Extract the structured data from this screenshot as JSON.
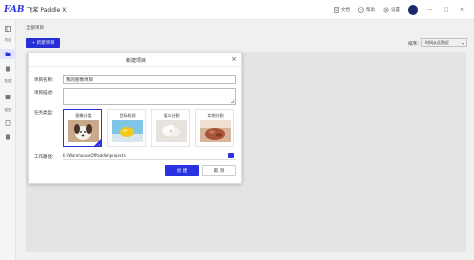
{
  "app": {
    "logo_mark": "FAB",
    "title": "飞桨 Paddle X"
  },
  "topbar": {
    "docs_label": "文档",
    "help_label": "帮助",
    "settings_label": "设置",
    "minimize": "—",
    "maximize": "□",
    "close": "×"
  },
  "sidebar": {
    "items": [
      {
        "icon": "menu-icon",
        "label": ""
      },
      {
        "icon": "project-icon",
        "label": "项目"
      },
      {
        "icon": "file-icon",
        "label": ""
      },
      {
        "icon": "data-icon",
        "label": "数据"
      },
      {
        "icon": "gear-icon",
        "label": ""
      },
      {
        "icon": "model-icon",
        "label": "模型"
      }
    ]
  },
  "main": {
    "breadcrumb": "全部项目",
    "new_project_button": "+ 新建项目",
    "sort_label": "排序：",
    "sort_value": "时间从远到近"
  },
  "modal": {
    "title": "新建项目",
    "name_label": "项目名称:",
    "name_value": "我的图像项目",
    "desc_label": "项目描述:",
    "desc_value": "",
    "task_label": "任务类型:",
    "task_types": [
      {
        "label": "图像分类",
        "selected": true
      },
      {
        "label": "目标检测",
        "selected": false
      },
      {
        "label": "语义分割",
        "selected": false
      },
      {
        "label": "实例分割",
        "selected": false
      }
    ],
    "path_label": "工作路径:",
    "path_value": "E:\\WarehouseOfPaddle\\projects",
    "create_button": "创 建",
    "cancel_button": "取 消"
  },
  "colors": {
    "accent": "#2932e1"
  }
}
